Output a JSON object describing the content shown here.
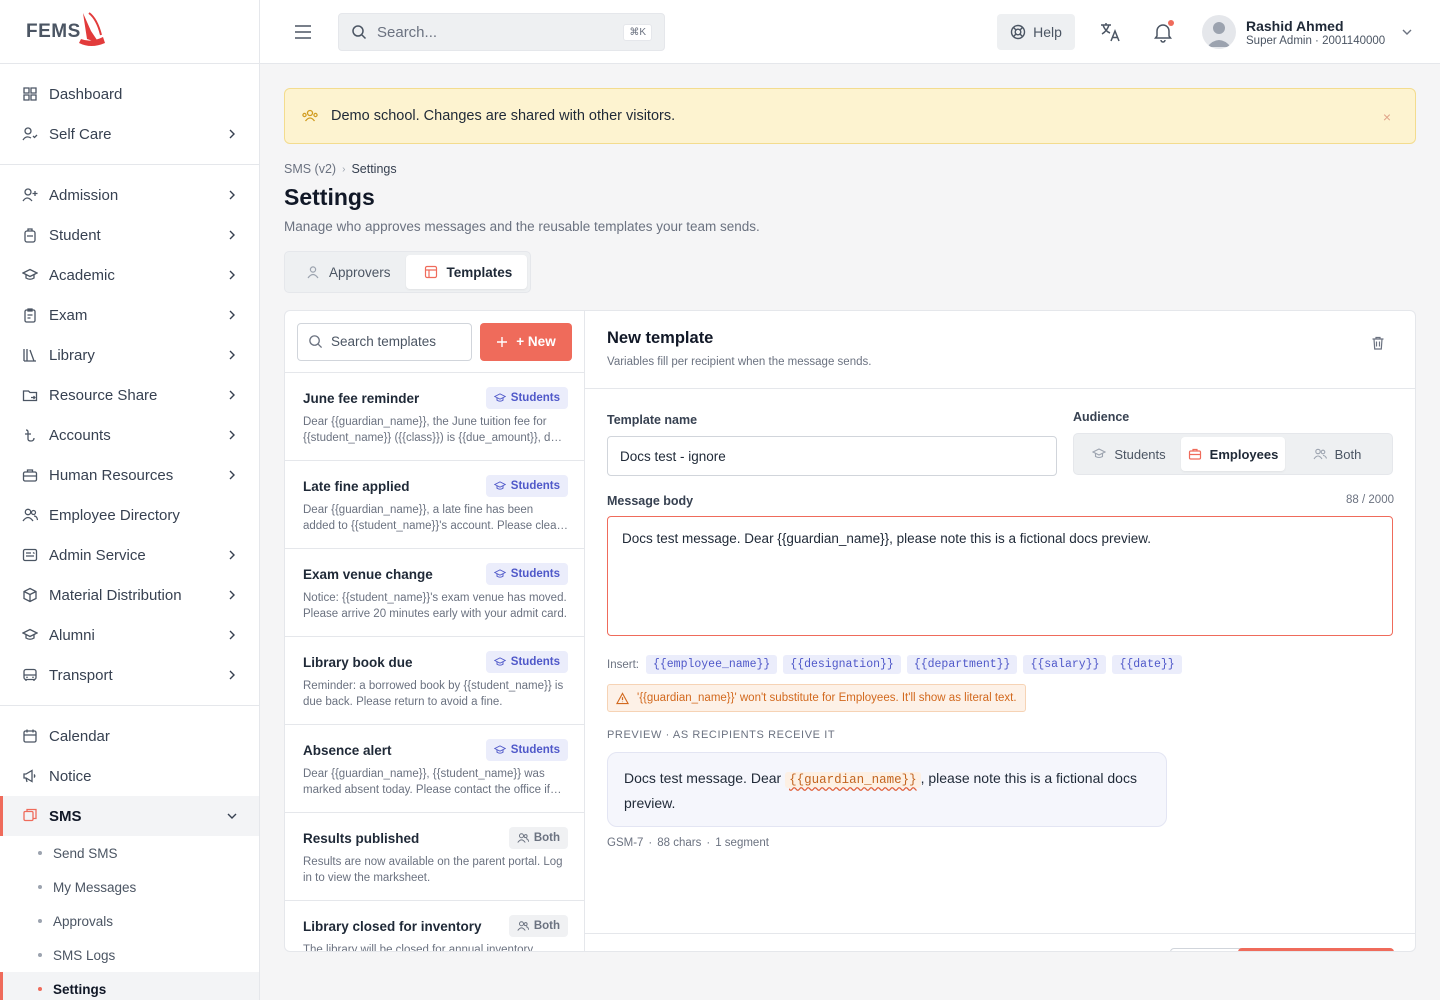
{
  "app": {
    "logo_text": "FEMS"
  },
  "sidebar": {
    "group1": [
      {
        "label": "Dashboard",
        "icon": "grid-icon",
        "chevron": false
      },
      {
        "label": "Self Care",
        "icon": "user-heart-icon",
        "chevron": true
      }
    ],
    "group2": [
      {
        "label": "Admission",
        "icon": "user-plus-icon",
        "chevron": true
      },
      {
        "label": "Student",
        "icon": "backpack-icon",
        "chevron": true
      },
      {
        "label": "Academic",
        "icon": "graduation-cap-icon",
        "chevron": true
      },
      {
        "label": "Exam",
        "icon": "clipboard-icon",
        "chevron": true
      },
      {
        "label": "Library",
        "icon": "books-icon",
        "chevron": true
      },
      {
        "label": "Resource Share",
        "icon": "folder-share-icon",
        "chevron": true
      },
      {
        "label": "Accounts",
        "icon": "taka-icon",
        "chevron": true
      },
      {
        "label": "Human Resources",
        "icon": "briefcase-icon",
        "chevron": true
      },
      {
        "label": "Employee Directory",
        "icon": "users-icon",
        "chevron": false
      },
      {
        "label": "Admin Service",
        "icon": "service-icon",
        "chevron": true
      },
      {
        "label": "Material Distribution",
        "icon": "box-icon",
        "chevron": true
      },
      {
        "label": "Alumni",
        "icon": "graduation-cap-icon",
        "chevron": true
      },
      {
        "label": "Transport",
        "icon": "bus-icon",
        "chevron": true
      }
    ],
    "group3": [
      {
        "label": "Calendar",
        "icon": "calendar-icon",
        "chevron": false
      },
      {
        "label": "Notice",
        "icon": "megaphone-icon",
        "chevron": false
      }
    ],
    "sms": {
      "label": "SMS",
      "sub": [
        "Send SMS",
        "My Messages",
        "Approvals",
        "SMS Logs",
        "Settings"
      ]
    }
  },
  "topbar": {
    "search_placeholder": "Search...",
    "shortcut": "⌘K",
    "help_label": "Help",
    "user_name": "Rashid Ahmed",
    "user_role": "Super Admin · 2001140000"
  },
  "banner": {
    "text": "Demo school. Changes are shared with other visitors.",
    "close": "×"
  },
  "breadcrumb": {
    "parent": "SMS (v2)",
    "current": "Settings"
  },
  "page": {
    "title": "Settings",
    "subtitle": "Manage who approves messages and the reusable templates your team sends.",
    "tabs": {
      "approvers": "Approvers",
      "templates": "Templates"
    }
  },
  "templates": {
    "search_placeholder": "Search templates",
    "new_label": "+ New",
    "items": [
      {
        "name": "June fee reminder",
        "audience": "Students",
        "kind": "students",
        "desc": "Dear {{guardian_name}}, the June tuition fee for {{student_name}} ({{class}}) is {{due_amount}}, due by {{due_date}}."
      },
      {
        "name": "Late fine applied",
        "audience": "Students",
        "kind": "students",
        "desc": "Dear {{guardian_name}}, a late fine has been added to {{student_name}}'s account. Please clear the dues."
      },
      {
        "name": "Exam venue change",
        "audience": "Students",
        "kind": "students",
        "desc": "Notice: {{student_name}}'s exam venue has moved. Please arrive 20 minutes early with your admit card."
      },
      {
        "name": "Library book due",
        "audience": "Students",
        "kind": "students",
        "desc": "Reminder: a borrowed book by {{student_name}} is due back. Please return to avoid a fine."
      },
      {
        "name": "Absence alert",
        "audience": "Students",
        "kind": "students",
        "desc": "Dear {{guardian_name}}, {{student_name}} was marked absent today. Please contact the office if needed."
      },
      {
        "name": "Results published",
        "audience": "Both",
        "kind": "both",
        "desc": "Results are now available on the parent portal. Log in to view the marksheet."
      },
      {
        "name": "Library closed for inventory",
        "audience": "Both",
        "kind": "both",
        "desc": "The library will be closed for annual inventory"
      }
    ]
  },
  "editor": {
    "title": "New template",
    "subtitle": "Variables fill per recipient when the message sends.",
    "name_label": "Template name",
    "name_value": "Docs test - ignore",
    "audience_label": "Audience",
    "audience_options": {
      "students": "Students",
      "employees": "Employees",
      "both": "Both"
    },
    "body_label": "Message body",
    "counter": "88 / 2000",
    "body_value": "Docs test message. Dear {{guardian_name}}, please note this is a fictional docs preview.",
    "insert_label": "Insert:",
    "chips": [
      "{{employee_name}}",
      "{{designation}}",
      "{{department}}",
      "{{salary}}",
      "{{date}}"
    ],
    "warning": "'{{guardian_name}}' won't substitute for Employees. It'll show as literal text.",
    "preview_label": "PREVIEW · AS RECIPIENTS RECEIVE IT",
    "preview": {
      "before": "Docs test message. Dear ",
      "var": "{{guardian_name}}",
      "after": ", please note this is a fictional docs preview."
    },
    "stats": {
      "encoding": "GSM-7",
      "chars": "88 chars",
      "segments": "1 segment",
      "sep": "·"
    }
  },
  "colors": {
    "accent": "#ef6b5b",
    "indigo": "#4f58c9",
    "banner_bg": "#fdf3d0"
  }
}
